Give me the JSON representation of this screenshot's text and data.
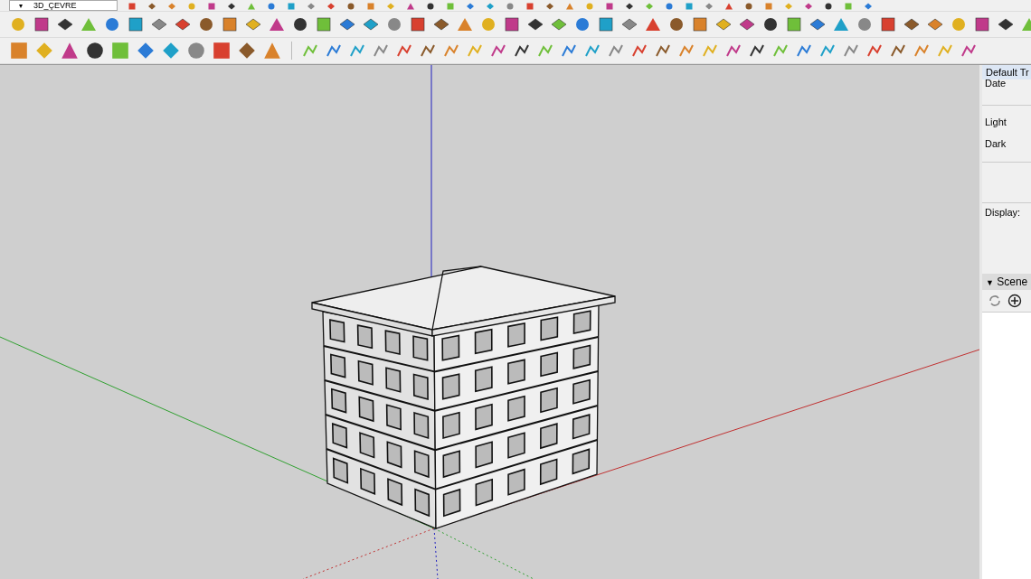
{
  "model_selector": {
    "caret": "▾",
    "value": "3D_ÇEVRE"
  },
  "tray": {
    "title": "Default Tr",
    "fields": [
      {
        "label": "Date"
      },
      {
        "label": "Light"
      },
      {
        "label": "Dark"
      },
      {
        "label": "Display:"
      }
    ],
    "scenes": {
      "toggle": "▼",
      "title": "Scene"
    }
  }
}
